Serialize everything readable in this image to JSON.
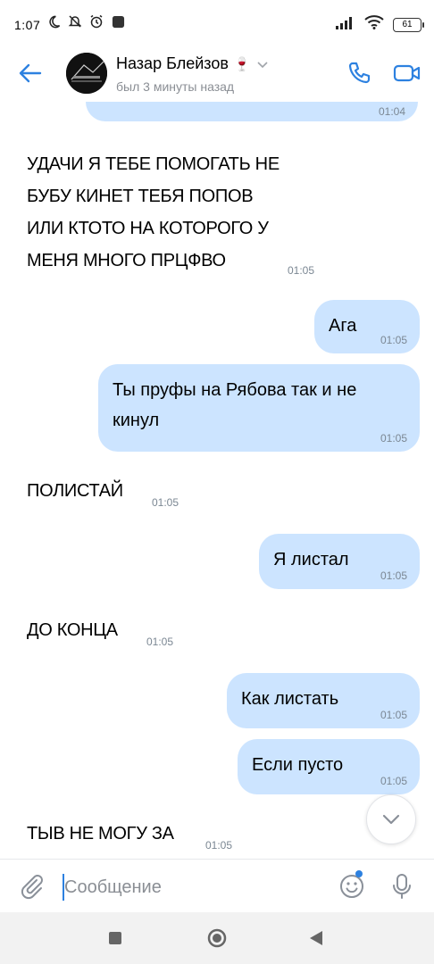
{
  "status_bar": {
    "time": "1:07",
    "battery": "61",
    "icons": [
      "moon-icon",
      "notifications-off-icon",
      "alarm-icon",
      "app-icon",
      "signal-icon",
      "wifi-icon",
      "battery-icon"
    ]
  },
  "header": {
    "contact_name": "Назар Блейзов",
    "name_emoji": "🍷",
    "status": "был 3 минуты назад",
    "accent_color": "#2d81e0",
    "icons": [
      "back-arrow-icon",
      "chevron-down-icon",
      "phone-icon",
      "video-camera-icon"
    ]
  },
  "messages": [
    {
      "direction": "out",
      "text": "",
      "time": "01:04"
    },
    {
      "direction": "in",
      "lines": [
        "УДАЧИ Я ТЕБЕ ПОМОГАТЬ НЕ",
        "БУБУ КИНЕТ ТЕБЯ ПОПОВ",
        "ИЛИ КТОТО НА КОТОРОГО У",
        "МЕНЯ МНОГО ПРЦФВО"
      ],
      "time": "01:05"
    },
    {
      "direction": "out",
      "text": "Ага",
      "time": "01:05"
    },
    {
      "direction": "out",
      "lines": [
        "Ты пруфы на Рябова так и не",
        "кинул"
      ],
      "time": "01:05"
    },
    {
      "direction": "in",
      "text": "ПОЛИСТАЙ",
      "time": "01:05"
    },
    {
      "direction": "out",
      "text": "Я листал",
      "time": "01:05"
    },
    {
      "direction": "in",
      "text": "ДО КОНЦА",
      "time": "01:05"
    },
    {
      "direction": "out",
      "text": "Как листать",
      "time": "01:05"
    },
    {
      "direction": "out",
      "text": "Если пусто",
      "time": "01:05"
    },
    {
      "direction": "in",
      "text": "ТЫВ НЕ МОГУ ЗА",
      "time": "01:05"
    }
  ],
  "composer": {
    "placeholder": "Сообщение",
    "icons": [
      "paperclip-icon",
      "emoji-icon",
      "microphone-icon"
    ]
  },
  "colors": {
    "outgoing_bubble": "#cce4ff",
    "accent": "#2d81e0",
    "time_text": "#7b8793"
  }
}
